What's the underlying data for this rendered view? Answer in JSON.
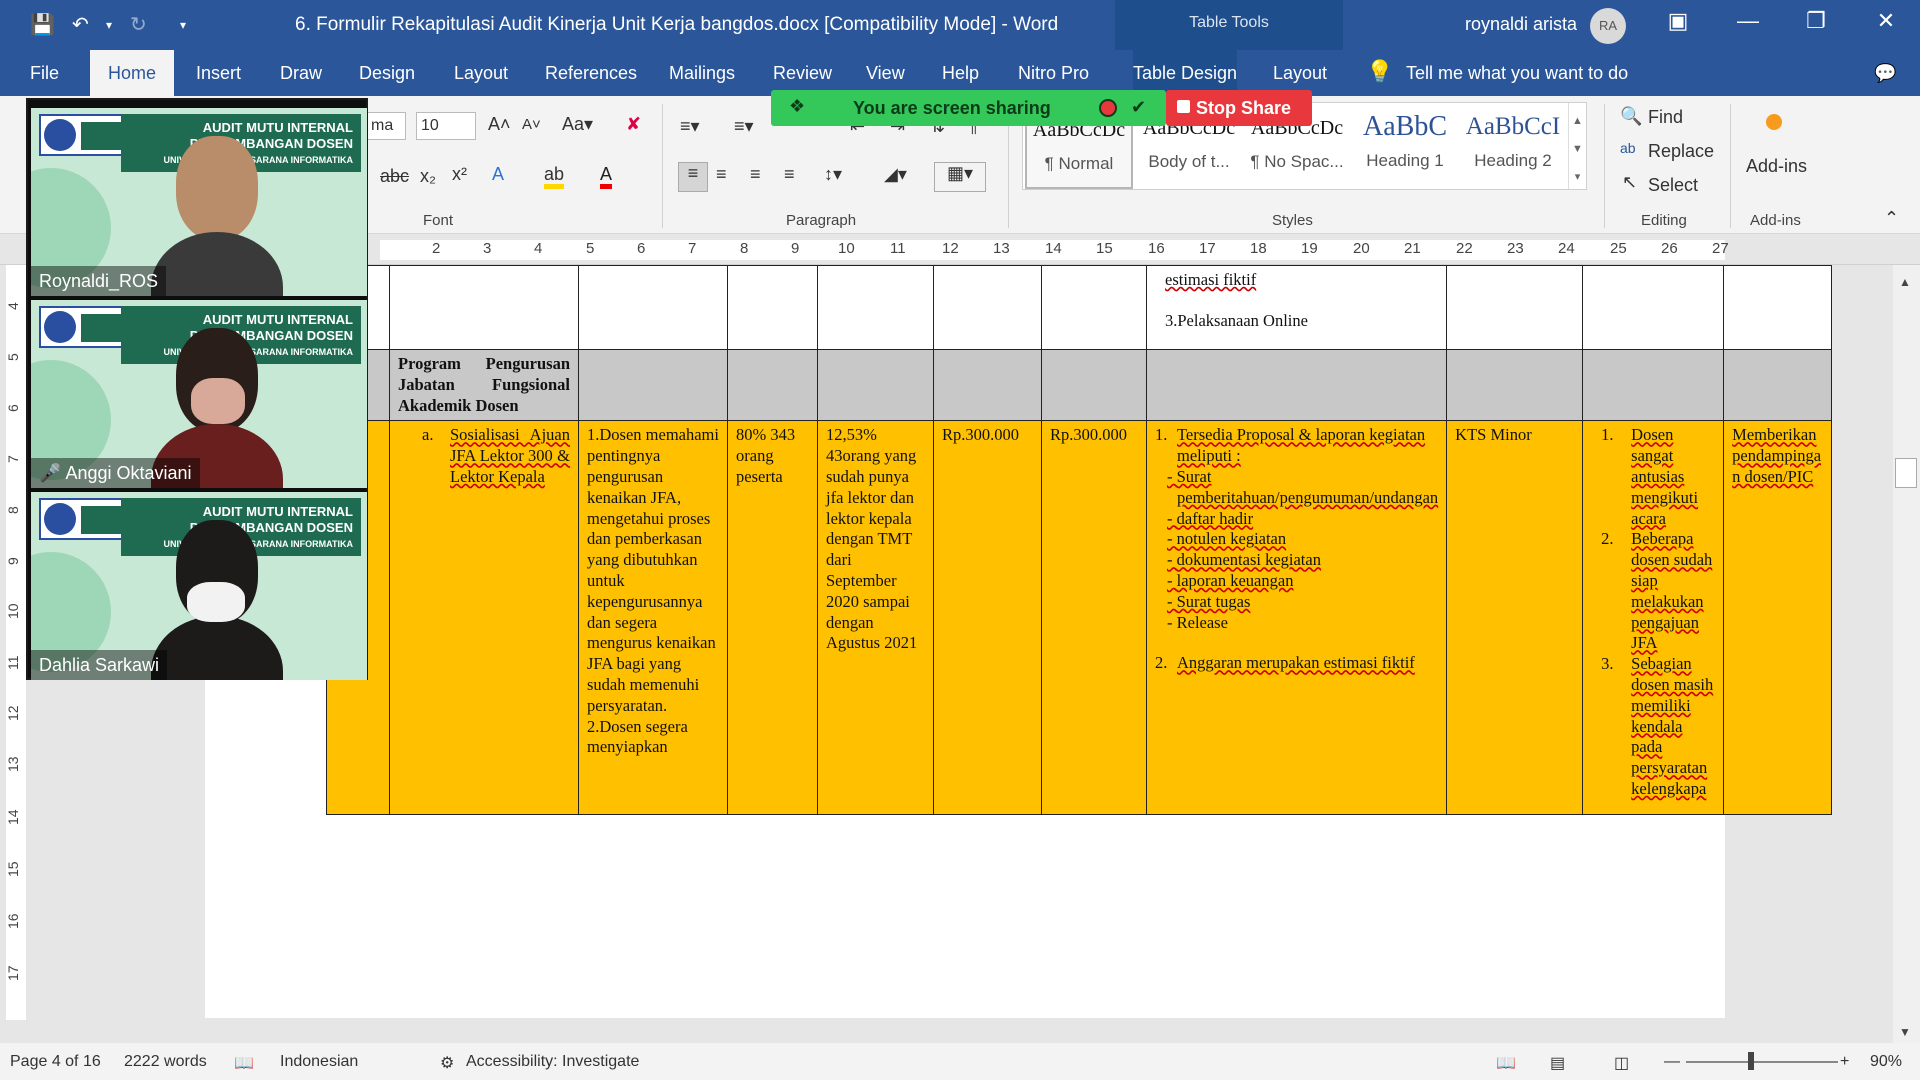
{
  "title_bar": {
    "document_title": "6. Formulir Rekapitulasi Audit Kinerja Unit Kerja bangdos.docx [Compatibility Mode]  -  Word",
    "table_tools": "Table Tools",
    "user_name": "roynaldi arista",
    "user_initials": "RA"
  },
  "tabs": [
    "File",
    "Home",
    "Insert",
    "Draw",
    "Design",
    "Layout",
    "References",
    "Mailings",
    "Review",
    "View",
    "Help",
    "Nitro Pro",
    "Table Design",
    "Layout"
  ],
  "tell_me": "Tell me what you want to do",
  "ribbon": {
    "font_name": "ma",
    "font_size": "10",
    "groups": [
      "Font",
      "Paragraph",
      "Styles",
      "Editing",
      "Add-ins"
    ],
    "styles": [
      {
        "preview": "AaBbCcDc",
        "name": "¶ Normal"
      },
      {
        "preview": "AaBbCcDc",
        "name": "Body of t..."
      },
      {
        "preview": "AaBbCcDc",
        "name": "¶ No Spac..."
      },
      {
        "preview": "AaBbC",
        "name": "Heading 1"
      },
      {
        "preview": "AaBbCcI",
        "name": "Heading 2"
      }
    ],
    "editing": {
      "find": "Find",
      "replace": "Replace",
      "select": "Select"
    },
    "addins": "Add-ins"
  },
  "screen_share": {
    "status": "You are screen sharing",
    "stop": "Stop Share"
  },
  "ruler_ticks": [
    "2",
    "3",
    "4",
    "5",
    "6",
    "7",
    "8",
    "9",
    "10",
    "11",
    "12",
    "13",
    "14",
    "15",
    "16",
    "17",
    "18",
    "19",
    "20",
    "21",
    "22",
    "23",
    "24",
    "25",
    "26",
    "27"
  ],
  "ruler_left_ticks": [
    "4",
    "5",
    "6",
    "7",
    "8",
    "9",
    "10",
    "11",
    "12",
    "13",
    "14",
    "15",
    "16",
    "17"
  ],
  "zoom_participants": [
    {
      "name": "Roynaldi_ROS"
    },
    {
      "name": "Anggi Oktaviani"
    },
    {
      "name": "Dahlia Sarkawi"
    }
  ],
  "zoom_banner": {
    "line1": "AUDIT MUTU INTERNAL",
    "line2": "PENGEMBANGAN DOSEN",
    "line3": "UNIVERSITAS BINA SARANA INFORMATIKA"
  },
  "table": {
    "row1": {
      "col7_a": "estimasi  fiktif",
      "col7_b": "3.Pelaksanaan Online"
    },
    "row2": {
      "program": "Program Pengurusan Jabatan Fungsional Akademik Dosen"
    },
    "row3": {
      "col1_num": "a.",
      "col1_text": "Sosialisasi Ajuan JFA Lektor 300 & Lektor Kepala",
      "col2": "1.Dosen memahami pentingnya pengurusan kenaikan JFA, mengetahui proses dan pemberkasan yang dibutuhkan untuk kepengurusannya dan segera mengurus kenaikan JFA bagi yang sudah memenuhi persyaratan. 2.Dosen segera menyiapkan",
      "col3": "80% 343 orang peserta",
      "col4": "12,53% 43orang yang sudah punya jfa lektor dan lektor kepala dengan TMT dari September 2020 sampai dengan Agustus 2021",
      "col5": "Rp.300.000",
      "col6": "Rp.300.000",
      "col7_item1": "Tersedia Proposal & laporan kegiatan meliputi :",
      "col7_list": [
        "Surat pemberitahuan/pengumuman/undangan",
        "daftar hadir",
        "notulen kegiatan",
        "dokumentasi kegiatan",
        "laporan keuangan",
        "Surat tugas",
        "Release"
      ],
      "col7_item2": "Anggaran merupakan estimasi  fiktif",
      "col8": "KTS Minor",
      "col9": [
        "Dosen sangat antusias mengikuti acara",
        "Beberapa dosen sudah siap melakukan pengajuan JFA",
        "Sebagian dosen masih memiliki kendala pada persyaratan kelengkapa"
      ],
      "col10": "Memberikan pendampingan dosen/PIC"
    }
  },
  "status_bar": {
    "page": "Page 4 of 16",
    "words": "2222 words",
    "language": "Indonesian",
    "accessibility": "Accessibility: Investigate",
    "zoom": "90%"
  }
}
